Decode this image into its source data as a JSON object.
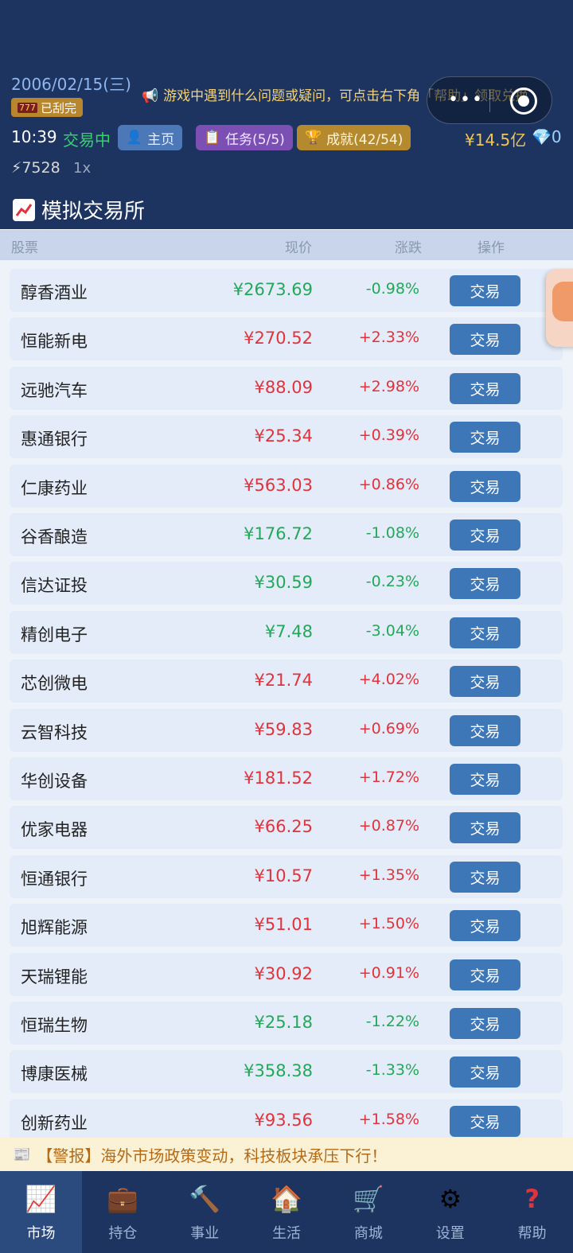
{
  "header": {
    "date": "2006/02/15(三)",
    "scratch_badge": "已刮完",
    "scratch_icon": "777",
    "marquee": "游戏中遇到什么问题或疑问，可点击右下角「帮助」领取兑换",
    "time": "10:39",
    "status": "交易中",
    "home_label": "主页",
    "tasks_label": "任务(5/5)",
    "achievements_label": "成就(42/54)",
    "money": "¥14.5亿",
    "gems": "0",
    "energy": "⚡7528",
    "speed": "1x"
  },
  "exchange": {
    "title": "模拟交易所",
    "columns": {
      "stock": "股票",
      "price": "现价",
      "change": "涨跌",
      "action": "操作"
    }
  },
  "stocks": [
    {
      "name": "醇香酒业",
      "price": "¥2673.69",
      "change": "-0.98%",
      "dir": "down",
      "action": "交易"
    },
    {
      "name": "恒能新电",
      "price": "¥270.52",
      "change": "+2.33%",
      "dir": "up",
      "action": "交易"
    },
    {
      "name": "远驰汽车",
      "price": "¥88.09",
      "change": "+2.98%",
      "dir": "up",
      "action": "交易"
    },
    {
      "name": "惠通银行",
      "price": "¥25.34",
      "change": "+0.39%",
      "dir": "up",
      "action": "交易"
    },
    {
      "name": "仁康药业",
      "price": "¥563.03",
      "change": "+0.86%",
      "dir": "up",
      "action": "交易"
    },
    {
      "name": "谷香酿造",
      "price": "¥176.72",
      "change": "-1.08%",
      "dir": "down",
      "action": "交易"
    },
    {
      "name": "信达证投",
      "price": "¥30.59",
      "change": "-0.23%",
      "dir": "down",
      "action": "交易"
    },
    {
      "name": "精创电子",
      "price": "¥7.48",
      "change": "-3.04%",
      "dir": "down",
      "action": "交易"
    },
    {
      "name": "芯创微电",
      "price": "¥21.74",
      "change": "+4.02%",
      "dir": "up",
      "action": "交易"
    },
    {
      "name": "云智科技",
      "price": "¥59.83",
      "change": "+0.69%",
      "dir": "up",
      "action": "交易"
    },
    {
      "name": "华创设备",
      "price": "¥181.52",
      "change": "+1.72%",
      "dir": "up",
      "action": "交易"
    },
    {
      "name": "优家电器",
      "price": "¥66.25",
      "change": "+0.87%",
      "dir": "up",
      "action": "交易"
    },
    {
      "name": "恒通银行",
      "price": "¥10.57",
      "change": "+1.35%",
      "dir": "up",
      "action": "交易"
    },
    {
      "name": "旭辉能源",
      "price": "¥51.01",
      "change": "+1.50%",
      "dir": "up",
      "action": "交易"
    },
    {
      "name": "天瑞锂能",
      "price": "¥30.92",
      "change": "+0.91%",
      "dir": "up",
      "action": "交易"
    },
    {
      "name": "恒瑞生物",
      "price": "¥25.18",
      "change": "-1.22%",
      "dir": "down",
      "action": "交易"
    },
    {
      "name": "博康医械",
      "price": "¥358.38",
      "change": "-1.33%",
      "dir": "down",
      "action": "交易"
    },
    {
      "name": "创新药业",
      "price": "¥93.56",
      "change": "+1.58%",
      "dir": "up",
      "action": "交易"
    }
  ],
  "alert": {
    "text": "【警报】海外市场政策变动，科技板块承压下行！"
  },
  "tabs": [
    {
      "label": "市场",
      "icon": "chart-icon",
      "glyph": "📈",
      "active": true
    },
    {
      "label": "持仓",
      "icon": "briefcase-icon",
      "glyph": "💼",
      "active": false
    },
    {
      "label": "事业",
      "icon": "hammer-icon",
      "glyph": "🔨",
      "active": false
    },
    {
      "label": "生活",
      "icon": "house-icon",
      "glyph": "🏠",
      "active": false
    },
    {
      "label": "商城",
      "icon": "cart-icon",
      "glyph": "🛒",
      "active": false
    },
    {
      "label": "设置",
      "icon": "gear-icon",
      "glyph": "⚙",
      "active": false
    },
    {
      "label": "帮助",
      "icon": "question-icon",
      "glyph": "?",
      "active": false
    }
  ],
  "colors": {
    "up": "#e0333c",
    "down": "#23a85a",
    "header_bg": "#1d3461",
    "trade_button": "#3d77b8"
  }
}
